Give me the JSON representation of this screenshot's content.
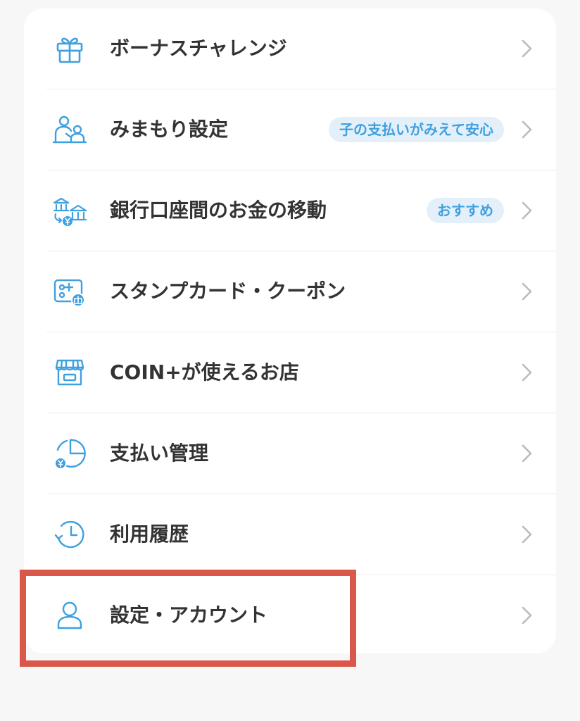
{
  "menu": {
    "items": [
      {
        "key": "bonus",
        "label": "ボーナスチャレンジ",
        "icon": "gift-icon",
        "badge": ""
      },
      {
        "key": "mimamori",
        "label": "みまもり設定",
        "icon": "family-icon",
        "badge": "子の支払いがみえて安心"
      },
      {
        "key": "bank",
        "label": "銀行口座間のお金の移動",
        "icon": "bank-transfer-icon",
        "badge": "おすすめ"
      },
      {
        "key": "stamp",
        "label": "スタンプカード・クーポン",
        "icon": "stamp-card-icon",
        "badge": ""
      },
      {
        "key": "stores",
        "label": "COIN+が使えるお店",
        "icon": "store-icon",
        "badge": ""
      },
      {
        "key": "payment",
        "label": "支払い管理",
        "icon": "pie-chart-yen-icon",
        "badge": ""
      },
      {
        "key": "history",
        "label": "利用履歴",
        "icon": "history-clock-icon",
        "badge": ""
      },
      {
        "key": "settings",
        "label": "設定・アカウント",
        "icon": "user-icon",
        "badge": ""
      }
    ]
  },
  "theme": {
    "accent": "#3fa0e0",
    "highlight": "#d9584a",
    "text": "#333333",
    "chevron": "#bbbbbb"
  }
}
